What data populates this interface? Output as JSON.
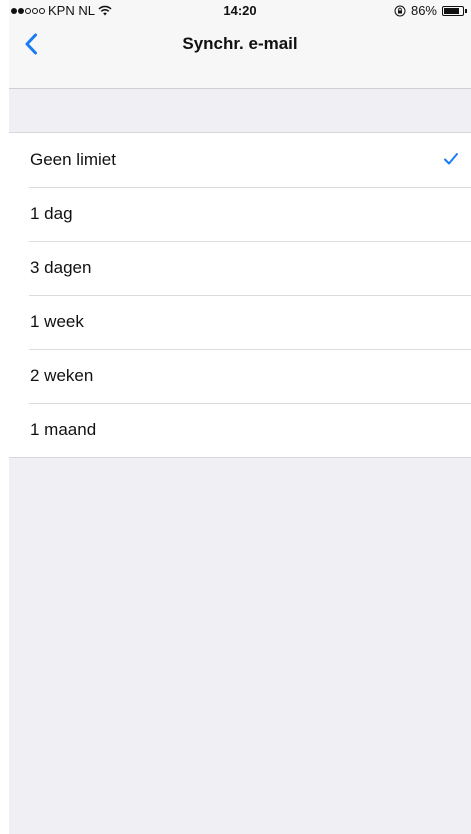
{
  "status_bar": {
    "carrier": "KPN NL",
    "signal_bars_filled": 2,
    "signal_bars_total": 5,
    "wifi_icon": "wifi-icon",
    "time": "14:20",
    "orientation_lock_icon": "orientation-lock-icon",
    "battery_percent_label": "86%",
    "battery_level": 0.86
  },
  "nav": {
    "back_icon": "chevron-left-icon",
    "title": "Synchr. e-mail"
  },
  "options": [
    {
      "label": "Geen limiet",
      "selected": true
    },
    {
      "label": "1 dag",
      "selected": false
    },
    {
      "label": "3 dagen",
      "selected": false
    },
    {
      "label": "1 week",
      "selected": false
    },
    {
      "label": "2 weken",
      "selected": false
    },
    {
      "label": "1 maand",
      "selected": false
    }
  ],
  "colors": {
    "accent": "#1a7cf3",
    "background": "#efeff4"
  }
}
